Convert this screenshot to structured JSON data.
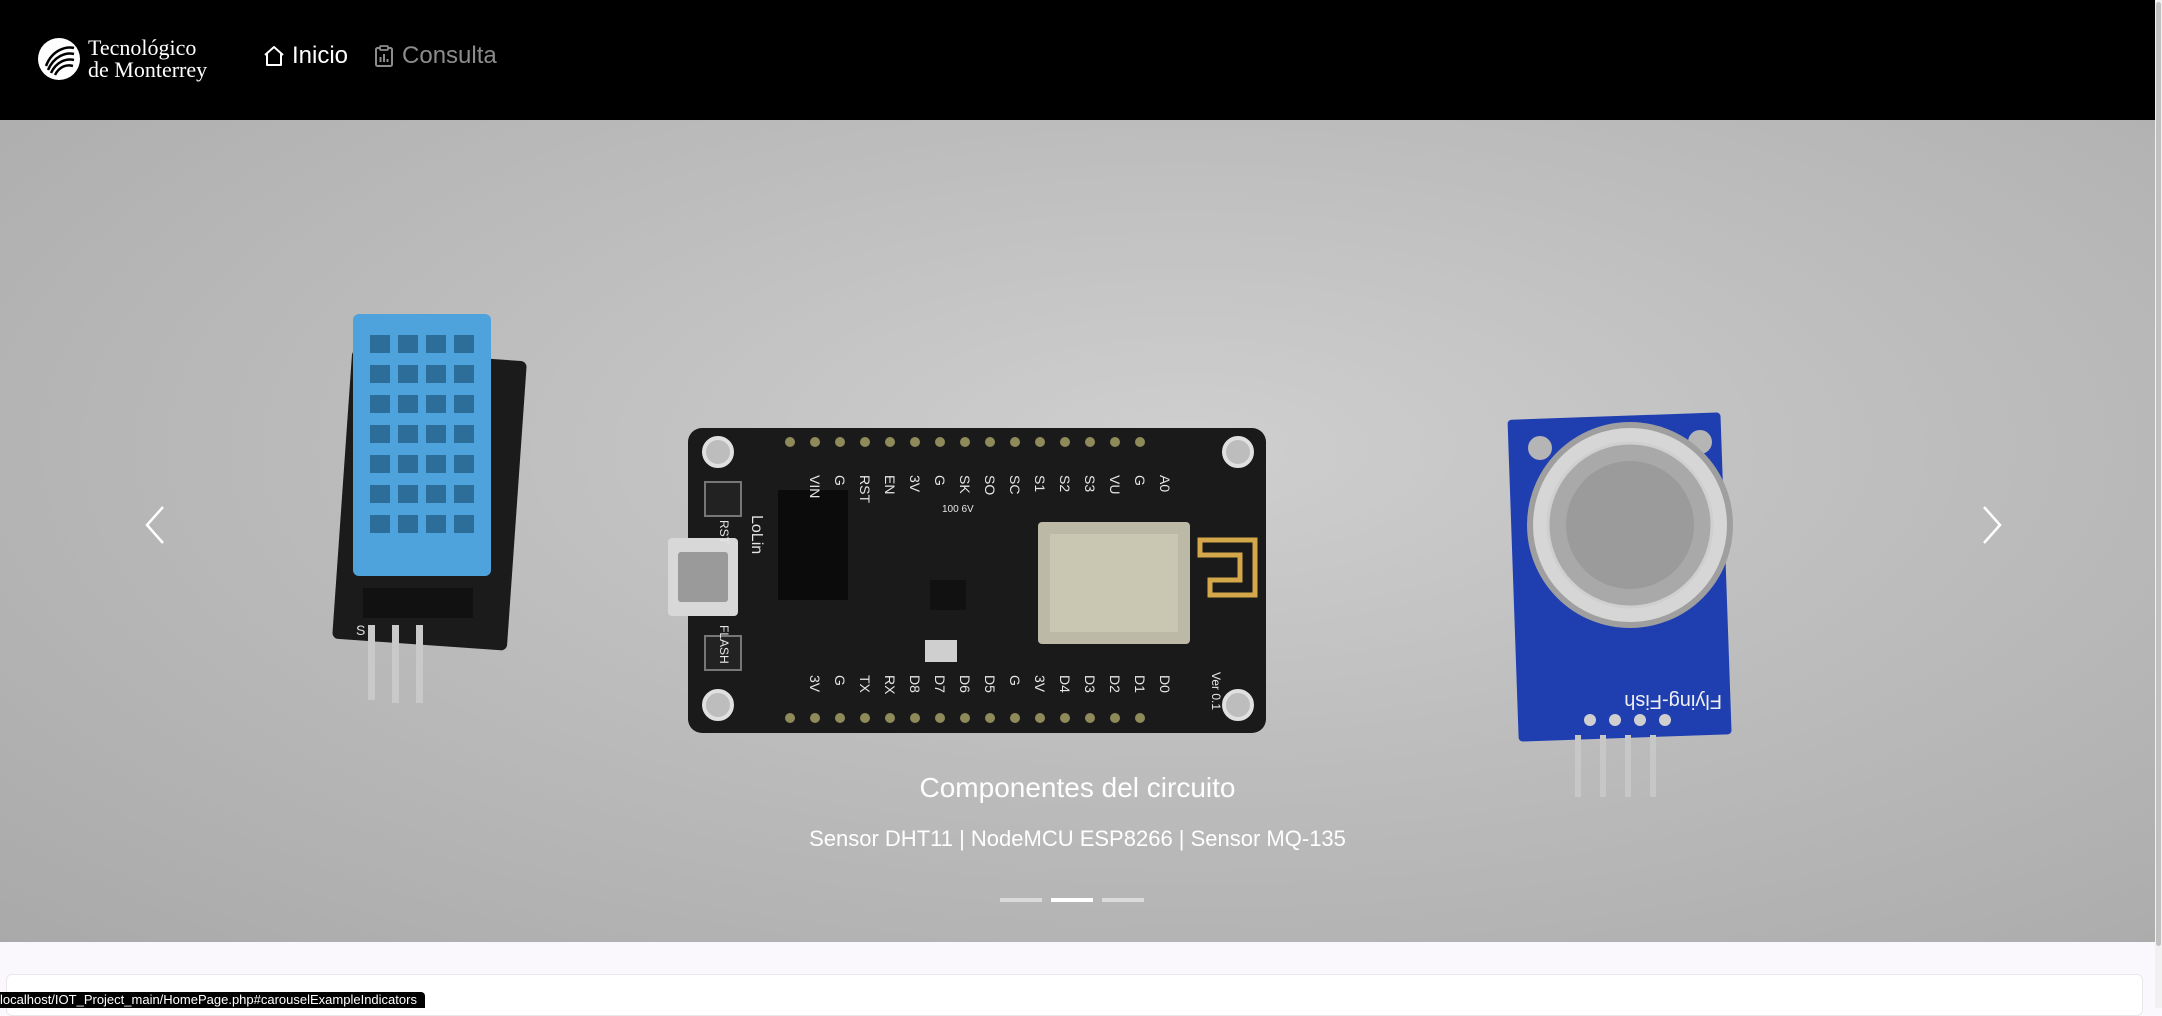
{
  "brand": {
    "line1": "Tecnológico",
    "line2": "de Monterrey",
    "logo": "tec-logo-icon"
  },
  "nav": {
    "items": [
      {
        "label": "Inicio",
        "icon": "home-icon",
        "active": true
      },
      {
        "label": "Consulta",
        "icon": "clipboard-chart-icon",
        "active": false
      }
    ]
  },
  "carousel": {
    "caption_title": "Componentes del circuito",
    "caption_subtitle": "Sensor DHT11 | NodeMCU ESP8266 | Sensor MQ-135",
    "active_index": 1,
    "indicator_count": 3,
    "prev_icon": "chevron-left-icon",
    "next_icon": "chevron-right-icon",
    "photo_labels": {
      "dht_pin": "S",
      "board_left": [
        "VIN",
        "G",
        "RST",
        "EN",
        "3V",
        "G",
        "SK",
        "SO",
        "SC",
        "S1",
        "S2",
        "S3",
        "VU",
        "G",
        "A0"
      ],
      "board_right": [
        "3V",
        "G",
        "TX",
        "RX",
        "D8",
        "D7",
        "D6",
        "D5",
        "G",
        "3V",
        "D4",
        "D3",
        "D2",
        "D1",
        "D0"
      ],
      "board_brand": "LoLin",
      "board_rst": "RST",
      "board_flash": "FLASH",
      "board_ver": "Ver 0.1",
      "cap_value": "100 6V",
      "mq_brand": "Flying-Fish"
    }
  },
  "status_url": "localhost/IOT_Project_main/HomePage.php#carouselExampleIndicators",
  "colors": {
    "navbar_bg": "#000000",
    "sensor_blue": "#4fa3dc",
    "mq_board": "#1f3fb0",
    "board_black": "#1a1a1a"
  }
}
